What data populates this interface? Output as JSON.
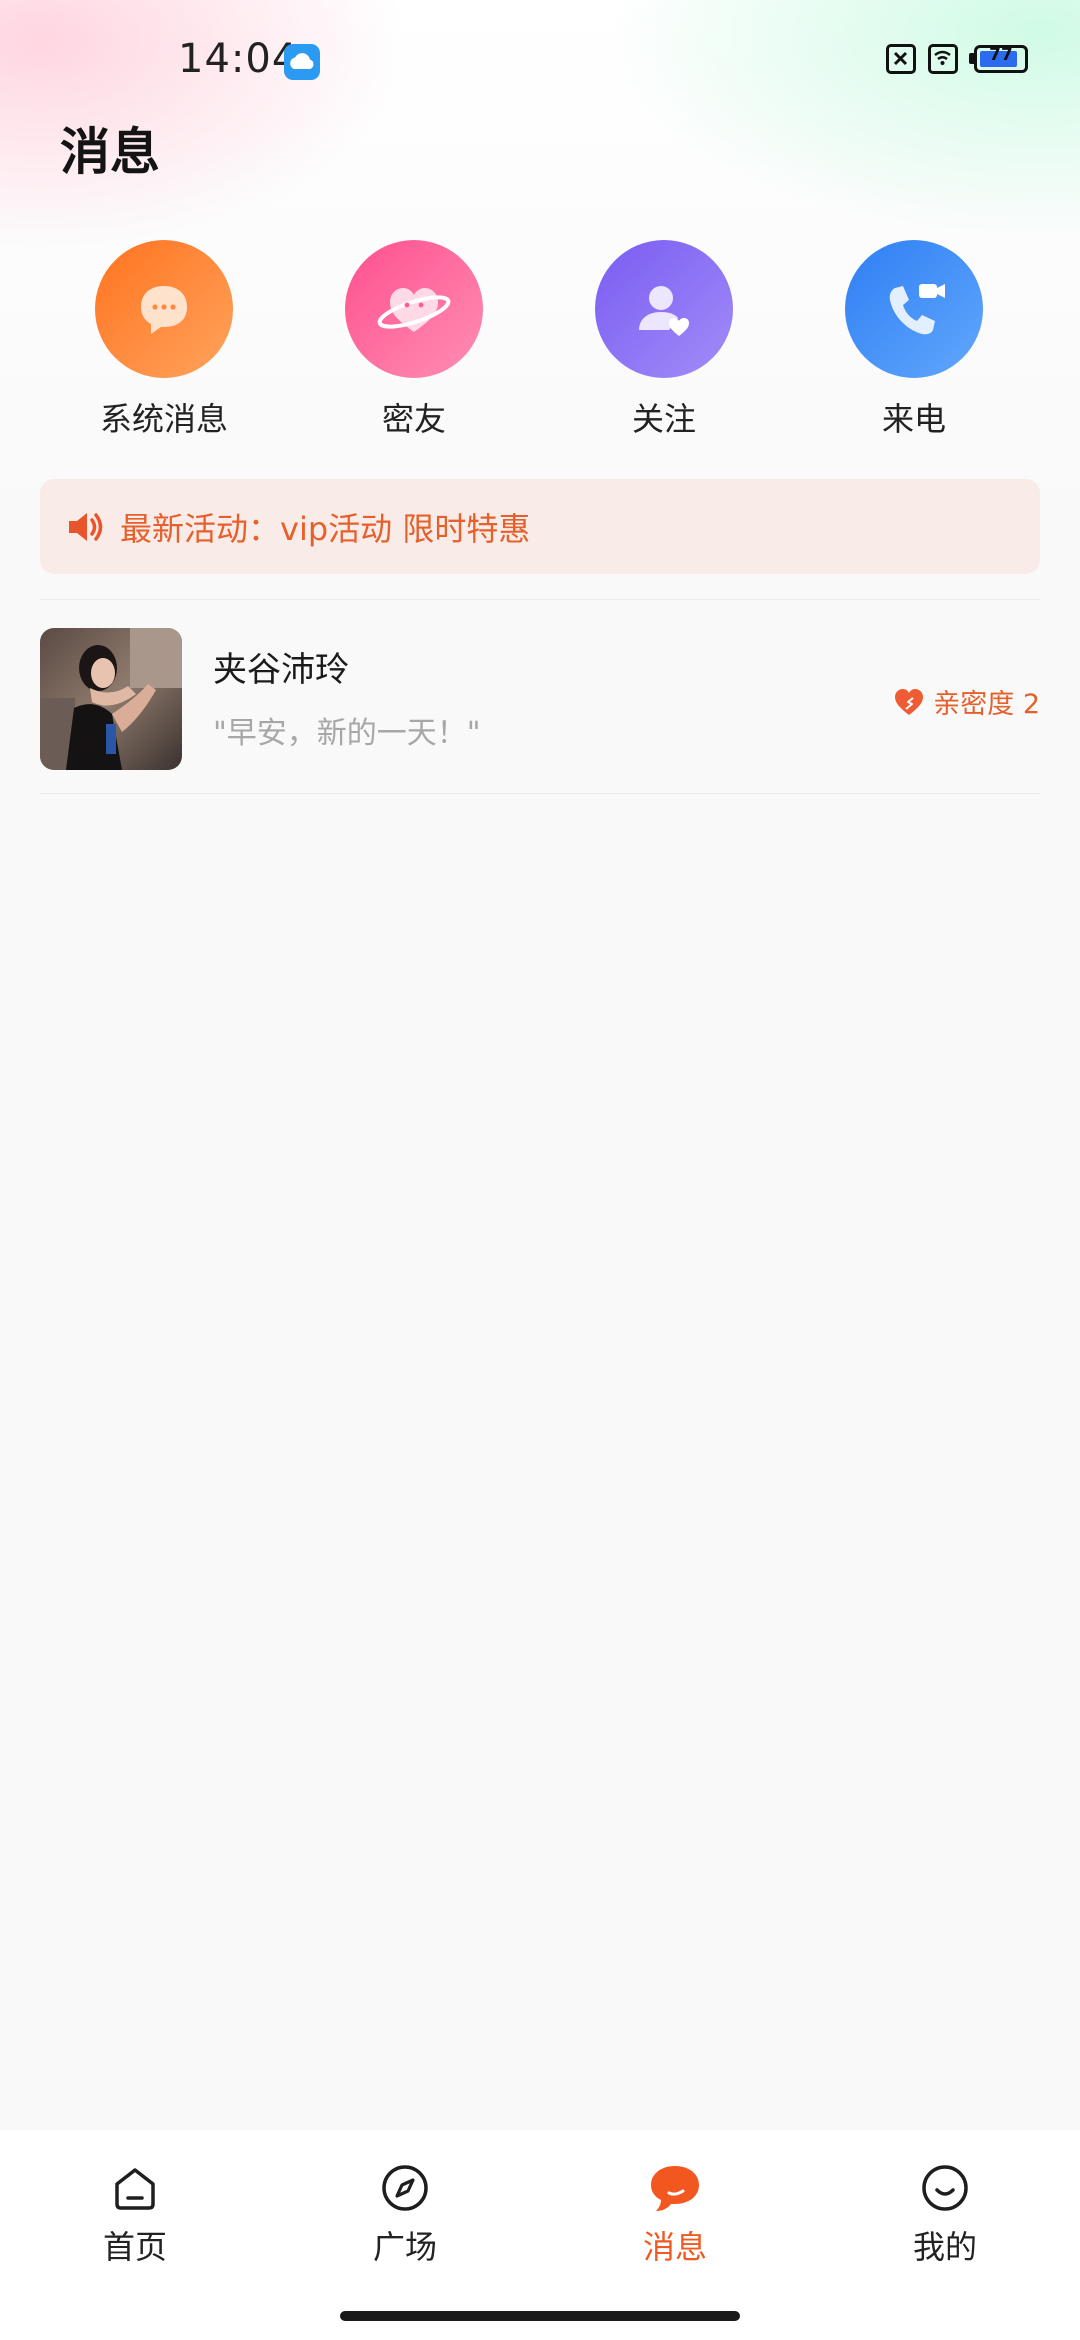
{
  "status_bar": {
    "time": "14:04",
    "battery": "77"
  },
  "page": {
    "title": "消息"
  },
  "shortcuts": [
    {
      "label": "系统消息",
      "icon": "chat-bubble-icon",
      "color_start": "#ff7320",
      "color_end": "#ffa35c"
    },
    {
      "label": "密友",
      "icon": "heart-planet-icon",
      "color_start": "#ff4f8e",
      "color_end": "#ff8fb3"
    },
    {
      "label": "关注",
      "icon": "person-heart-icon",
      "color_start": "#7a5cf2",
      "color_end": "#a28cf8"
    },
    {
      "label": "来电",
      "icon": "phone-video-icon",
      "color_start": "#2f7ff5",
      "color_end": "#61a7fb"
    }
  ],
  "banner": {
    "icon": "speaker-icon",
    "text": "最新活动：vip活动 限时特惠"
  },
  "chats": [
    {
      "name": "夹谷沛玲",
      "preview": "\"早安，新的一天！\"",
      "intimacy_label": "亲密度 2",
      "intimacy_icon": "heart-icon"
    }
  ],
  "nav": {
    "items": [
      {
        "label": "首页",
        "icon": "home-icon"
      },
      {
        "label": "广场",
        "icon": "compass-icon"
      },
      {
        "label": "消息",
        "icon": "message-icon"
      },
      {
        "label": "我的",
        "icon": "smile-icon"
      }
    ],
    "active": "消息"
  },
  "colors": {
    "accent": "#f05a22",
    "banner_bg": "#f9ebe8",
    "banner_text": "#e6602c"
  }
}
